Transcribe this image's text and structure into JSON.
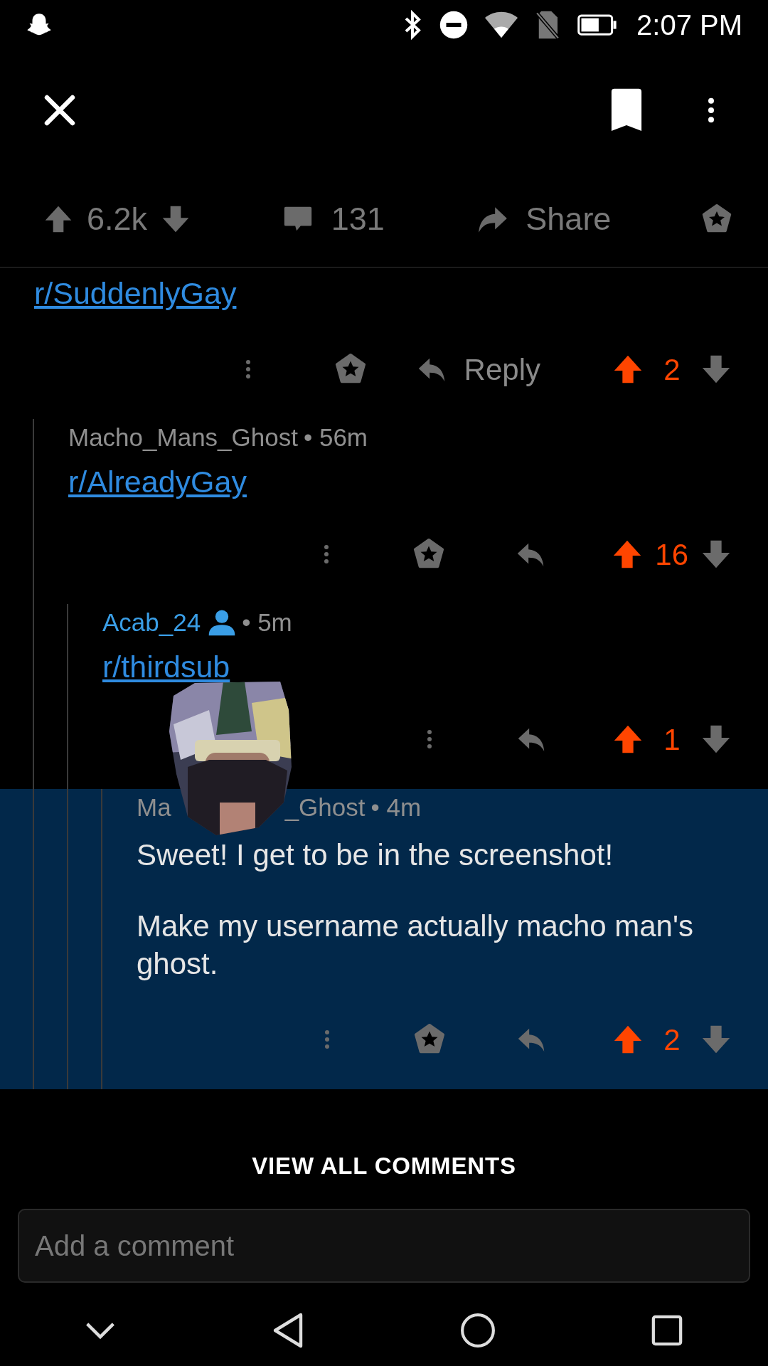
{
  "status_bar": {
    "time": "2:07 PM"
  },
  "post_actions": {
    "score": "6.2k",
    "comments": "131",
    "share": "Share"
  },
  "comments": [
    {
      "highlighted": false,
      "body": [
        {
          "kind": "link",
          "text": "r/SuddenlyGay"
        }
      ],
      "actions": {
        "award": true,
        "reply_label": "Reply",
        "score": "2",
        "upvoted": true
      },
      "children": [
        {
          "highlighted": false,
          "author_parts": [
            "Macho_Mans_Ghost"
          ],
          "is_you": false,
          "meta": "• 56m",
          "body": [
            {
              "kind": "link",
              "text": "r/AlreadyGay"
            }
          ],
          "actions": {
            "award": true,
            "score": "16",
            "upvoted": true
          },
          "children": [
            {
              "highlighted": false,
              "author_parts": [
                "Acab_24"
              ],
              "is_you": true,
              "meta": "• 5m",
              "body": [
                {
                  "kind": "link",
                  "text": "r/thirdsub"
                }
              ],
              "actions": {
                "award": false,
                "score": "1",
                "upvoted": true
              },
              "children": [
                {
                  "highlighted": true,
                  "author_parts": [
                    "Ma",
                    "_Ghost"
                  ],
                  "is_you": false,
                  "meta": "• 4m",
                  "body": [
                    {
                      "kind": "text",
                      "text": "Sweet! I get to be in the screenshot!"
                    },
                    {
                      "kind": "text",
                      "text": "Make my username actually macho man's ghost."
                    }
                  ],
                  "actions": {
                    "award": true,
                    "score": "2",
                    "upvoted": true
                  }
                }
              ]
            }
          ]
        }
      ]
    }
  ],
  "view_all": "VIEW ALL COMMENTS",
  "comment_field": {
    "placeholder": "Add a comment"
  }
}
